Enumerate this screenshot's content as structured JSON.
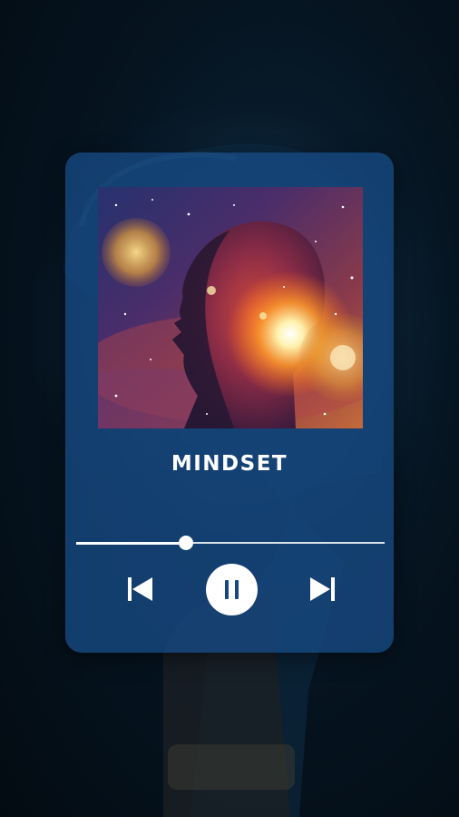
{
  "player": {
    "track_title": "MINDSET",
    "progress_fraction": 0.355,
    "album_art_icon": "cosmic-head-silhouette",
    "controls": {
      "prev_icon": "skip-previous-icon",
      "play_pause_icon": "pause-icon",
      "next_icon": "skip-next-icon"
    }
  },
  "colors": {
    "card_background": "#164880",
    "text": "#ffffff",
    "page_background": "#061522"
  }
}
